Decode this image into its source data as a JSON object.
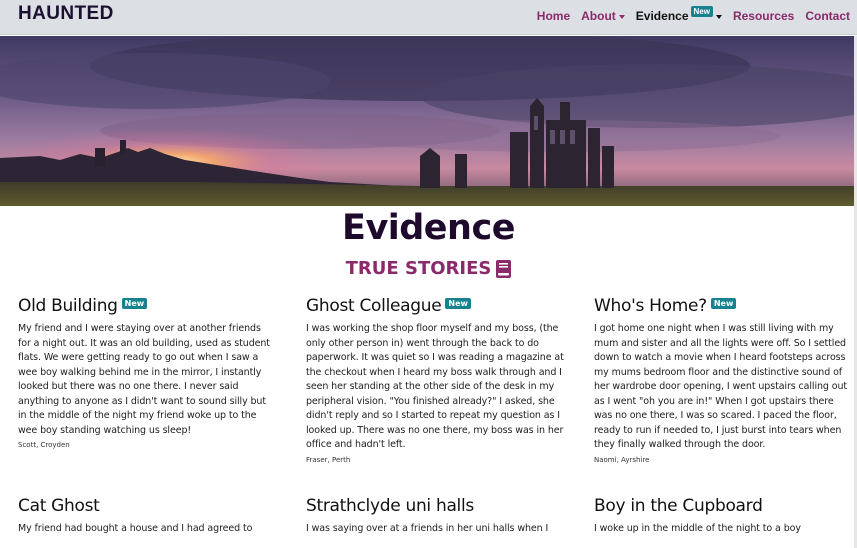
{
  "navbar": {
    "brand": "HAUNTED",
    "items": [
      {
        "label": "Home"
      },
      {
        "label": "About"
      },
      {
        "label": "Evidence",
        "badge": "New"
      },
      {
        "label": "Resources"
      },
      {
        "label": "Contact"
      }
    ]
  },
  "hero": {
    "image": "sunset-abbey-ruins-photo"
  },
  "page": {
    "title": "Evidence",
    "subtitle": "TRUE STORIES",
    "subtitle_icon": "book-icon"
  },
  "colors": {
    "accent": "#8a2a6b",
    "badge": "#16828f",
    "title": "#1e0a2c",
    "navbar_bg": "#dcdfe3"
  },
  "stories": [
    {
      "title": "Old Building",
      "badge": "New",
      "text": "My friend and I were staying over at another friends for a night out. It was an old building, used as student flats. We were getting ready to go out when I saw a wee boy walking behind me in the mirror, I instantly looked but there was no one there. I never said anything to anyone as I didn't want to sound silly but in the middle of the night my friend woke up to the wee boy standing watching us sleep!",
      "author": "Scott, Croyden"
    },
    {
      "title": "Ghost Colleague",
      "badge": "New",
      "text": "I was working the shop floor myself and my boss, (the only other person in) went through the back to do paperwork. It was quiet so I was reading a magazine at the checkout when I heard my boss walk through and I seen her standing at the other side of the desk in my peripheral vision. \"You finished already?\" I asked, she didn't reply and so I started to repeat my question as I looked up. There was no one there, my boss was in her office and hadn't left.",
      "author": "Fraser, Perth"
    },
    {
      "title": "Who's Home?",
      "badge": "New",
      "text": "I got home one night when I was still living with my mum and sister and all the lights were off. So I settled down to watch a movie when I heard footsteps across my mums bedroom floor and the distinctive sound of her wardrobe door opening, I went upstairs calling out as I went \"oh you are in!\" When I got upstairs there was no one there, I was so scared. I paced the floor, ready to run if needed to, I just burst into tears when they finally walked through the door.",
      "author": "Naomi, Ayrshire"
    },
    {
      "title": "Cat Ghost",
      "text": "My friend had bought a house and I had agreed to"
    },
    {
      "title": "Strathclyde uni halls",
      "text": "I was saying over at a friends in her uni halls when I"
    },
    {
      "title": "Boy in the Cupboard",
      "text": "I woke up in the middle of the night to a boy"
    }
  ]
}
